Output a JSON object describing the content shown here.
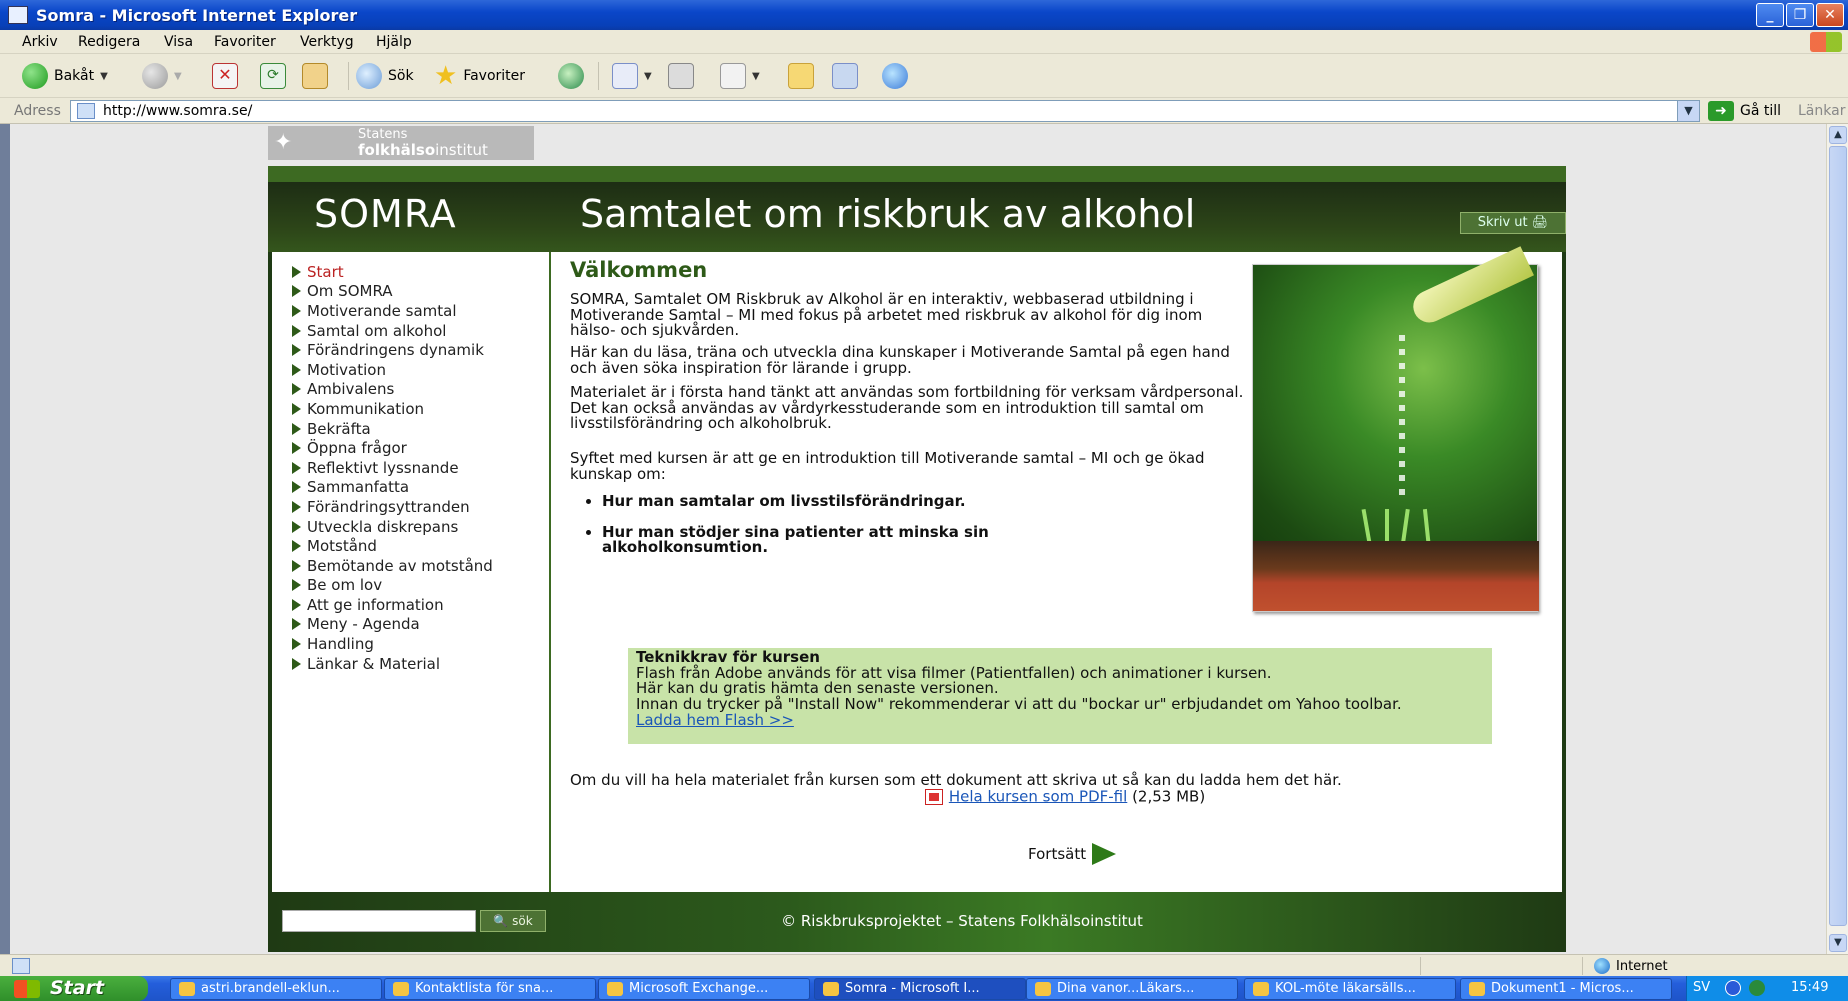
{
  "window": {
    "title": "Somra - Microsoft Internet Explorer",
    "controls": {
      "minimize": "_",
      "maximize": "❐",
      "close": "✕"
    }
  },
  "menu": [
    "Arkiv",
    "Redigera",
    "Visa",
    "Favoriter",
    "Verktyg",
    "Hjälp"
  ],
  "toolbar": {
    "back_label": "Bakåt",
    "search_label": "Sök",
    "favorites_label": "Favoriter"
  },
  "address": {
    "label": "Adress",
    "url": "http://www.somra.se/",
    "go_label": "Gå till",
    "links_label": "Länkar"
  },
  "logo": {
    "line1": "Statens",
    "line2_bold": "folkhälso",
    "line2_rest": "institut"
  },
  "site": {
    "brand": "SOMRA",
    "subtitle": "Samtalet om riskbruk av alkohol",
    "print_label": "Skriv ut",
    "nav": [
      {
        "label": "Start",
        "active": true
      },
      {
        "label": "Om SOMRA"
      },
      {
        "label": "Motiverande samtal"
      },
      {
        "label": "Samtal om alkohol"
      },
      {
        "label": "Förändringens dynamik"
      },
      {
        "label": "Motivation"
      },
      {
        "label": "Ambivalens"
      },
      {
        "label": "Kommunikation"
      },
      {
        "label": "Bekräfta"
      },
      {
        "label": "Öppna frågor"
      },
      {
        "label": "Reflektivt lyssnande"
      },
      {
        "label": "Sammanfatta"
      },
      {
        "label": "Förändringsyttranden"
      },
      {
        "label": "Utveckla diskrepans"
      },
      {
        "label": "Motstånd"
      },
      {
        "label": "Bemötande av motstånd"
      },
      {
        "label": "Be om lov"
      },
      {
        "label": "Att ge information"
      },
      {
        "label": "Meny - Agenda"
      },
      {
        "label": "Handling"
      },
      {
        "label": "Länkar & Material"
      }
    ],
    "main": {
      "heading": "Välkommen",
      "paragraphs": [
        "SOMRA, Samtalet OM Riskbruk av Alkohol är en interaktiv, webbaserad utbildning i Motiverande Samtal – MI med fokus på arbetet med riskbruk av alkohol för dig inom hälso- och sjukvården.",
        "Här kan du läsa, träna och utveckla dina kunskaper i Motiverande Samtal på egen hand och även söka inspiration för lärande i grupp.",
        "Materialet är i första hand tänkt att användas som fortbildning för verksam vårdpersonal. Det kan också användas av vårdyrkesstuderande som en introduktion till samtal om livsstilsförändring och alkoholbruk.",
        "Syftet med kursen är att ge en introduktion till Motiverande samtal – MI och ge ökad kunskap om:"
      ],
      "bullets": [
        "Hur man samtalar om livsstilsförändringar.",
        "Hur man stödjer sina patienter att minska sin alkoholkonsumtion."
      ],
      "tech": {
        "title": "Teknikkrav för kursen",
        "line1": "Flash från Adobe används för att visa filmer (Patientfallen) och animationer i kursen.",
        "line2": "Här kan du gratis hämta den senaste versionen.",
        "line3": "Innan du trycker på \"Install Now\" rekommenderar vi att du \"bockar ur\" erbjudandet om Yahoo toolbar.",
        "link": "Ladda hem Flash >>"
      },
      "pdf_intro": "Om du vill ha hela materialet från kursen som ett dokument att skriva ut så kan du ladda hem det här.",
      "pdf_link": "Hela kursen som PDF-fil",
      "pdf_size": "(2,53 MB)",
      "continue_label": "Fortsätt"
    },
    "footer": {
      "search_button": "sök",
      "copyright": "© Riskbruksprojektet  – Statens Folkhälsoinstitut"
    }
  },
  "statusbar": {
    "zone": "Internet"
  },
  "taskbar": {
    "start_label": "Start",
    "tasks": [
      {
        "label": "astri.brandell-eklun...",
        "active": false
      },
      {
        "label": "Kontaktlista för sna...",
        "active": false
      },
      {
        "label": "Microsoft Exchange...",
        "active": false
      },
      {
        "label": "Somra - Microsoft I...",
        "active": true
      },
      {
        "label": "Dina vanor...Läkars...",
        "active": false
      },
      {
        "label": "KOL-möte läkarsälls...",
        "active": false
      },
      {
        "label": "Dokument1 - Micros...",
        "active": false
      }
    ],
    "lang": "SV",
    "clock": "15:49"
  },
  "colors": {
    "site_green": "#3d6a22",
    "heading_green": "#2e5a18",
    "tech_box": "#c8e3a8",
    "active_nav": "#bb2222",
    "link": "#1a56b8"
  }
}
